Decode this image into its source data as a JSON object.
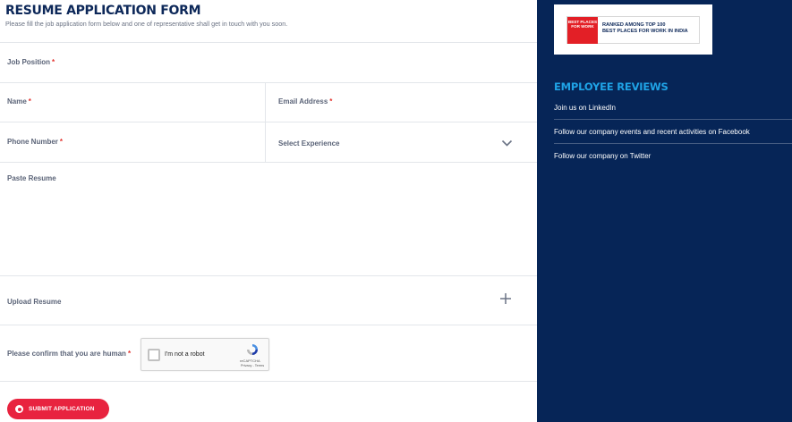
{
  "form": {
    "title": "RESUME APPLICATION FORM",
    "subtitle": "Please fill the job application form below and one of representative shall get in touch with you soon.",
    "fields": {
      "job_position": {
        "label": "Job Position",
        "required": "*"
      },
      "name": {
        "label": "Name",
        "required": "*"
      },
      "email": {
        "label": "Email Address",
        "required": "*"
      },
      "phone": {
        "label": "Phone Number",
        "required": "*"
      },
      "experience": {
        "label": "Select Experience"
      },
      "paste_resume": {
        "label": "Paste Resume"
      },
      "upload_resume": {
        "label": "Upload Resume"
      },
      "human_confirm": {
        "label": "Please confirm that you are human",
        "required": "*"
      }
    },
    "captcha": {
      "text": "I'm not a robot",
      "brand": "reCAPTCHA",
      "links": "Privacy - Terms"
    },
    "submit_label": "SUBMIT APPLICATION"
  },
  "sidebar": {
    "badge": {
      "logo_text": "BEST PLACES FOR WORK",
      "line1": "RANKED AMONG TOP 100",
      "line2": "BEST PLACES FOR WORK IN INDIA"
    },
    "reviews_title": "EMPLOYEE REVIEWS",
    "links": [
      {
        "label": "Join us on LinkedIn"
      },
      {
        "label": "Follow our company events and recent activities on Facebook"
      },
      {
        "label": "Follow our company on Twitter"
      }
    ]
  },
  "colors": {
    "sidebar_bg": "#062557",
    "accent_blue": "#1fa3e6",
    "submit_red": "#e8233f",
    "title_navy": "#0d2859"
  },
  "icons": {
    "experience_dropdown": "chevron-down-icon",
    "upload": "plus-icon",
    "submit": "radio-dot-icon",
    "captcha": "recaptcha-logo-icon"
  }
}
